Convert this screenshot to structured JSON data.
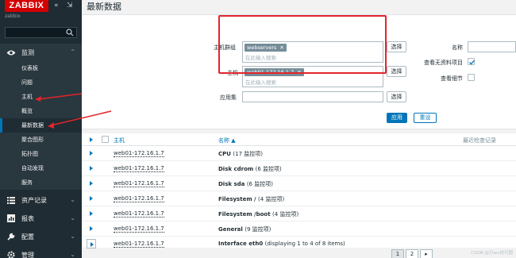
{
  "brand": {
    "logo": "ZABBIX",
    "collapse_icon": "«",
    "popout_icon": "⇲",
    "server_name": "zabbix"
  },
  "search": {
    "placeholder": "",
    "icon": "search-icon"
  },
  "sidebar": {
    "monitoring": {
      "label": "监测",
      "icon": "eye-icon"
    },
    "monitoring_items": [
      {
        "label": "仪表板"
      },
      {
        "label": "问题"
      },
      {
        "label": "主机"
      },
      {
        "label": "概览"
      },
      {
        "label": "最新数据",
        "active": true
      },
      {
        "label": "聚合图形"
      },
      {
        "label": "拓扑图"
      },
      {
        "label": "自动发现"
      },
      {
        "label": "服务"
      }
    ],
    "sections": [
      {
        "label": "资产记录",
        "icon": "list-icon"
      },
      {
        "label": "报表",
        "icon": "chart-icon"
      },
      {
        "label": "配置",
        "icon": "wrench-icon"
      },
      {
        "label": "管理",
        "icon": "gear-icon"
      }
    ]
  },
  "page": {
    "title": "最新数据"
  },
  "filter": {
    "host_groups": {
      "label": "主机群组",
      "tag": "webservers",
      "placeholder": "在此输入搜索",
      "select_label": "选择"
    },
    "hosts": {
      "label": "主机",
      "tag": "web01-172.16.1.7",
      "placeholder": "在此输入搜索",
      "select_label": "选择"
    },
    "application": {
      "label": "应用集",
      "value": "",
      "select_label": "选择"
    },
    "name": {
      "label": "名称",
      "value": ""
    },
    "show_items_without_data": {
      "label": "查看无资料项目",
      "checked": true
    },
    "show_details": {
      "label": "查看细节",
      "checked": false
    },
    "apply_label": "应用",
    "reset_label": "重设"
  },
  "table": {
    "columns": {
      "host": "主机",
      "name": "名称 ▲",
      "last_check": "最近检查记录"
    },
    "rows": [
      {
        "host": "web01-172.16.1.7",
        "app": "CPU",
        "count": "(17 监控项)"
      },
      {
        "host": "web01-172.16.1.7",
        "app": "Disk cdrom",
        "count": "(6 监控项)"
      },
      {
        "host": "web01-172.16.1.7",
        "app": "Disk sda",
        "count": "(6 监控项)"
      },
      {
        "host": "web01-172.16.1.7",
        "app": "Filesystem /",
        "count": "(4 监控项)"
      },
      {
        "host": "web01-172.16.1.7",
        "app": "Filesystem /boot",
        "count": "(4 监控项)"
      },
      {
        "host": "web01-172.16.1.7",
        "app": "General",
        "count": "(9 监控项)"
      },
      {
        "host": "web01-172.16.1.7",
        "app": "Interface eth0",
        "count": "(displaying 1 to 4 of 8 items)",
        "expanded": true
      }
    ]
  },
  "pager": {
    "pages": [
      "1",
      "2"
    ],
    "next": "▸",
    "current": "1"
  },
  "watermark": "CSDN @万wu技可圆",
  "colors": {
    "sidebar_bg": "#1f2c33",
    "brand_red": "#d40000",
    "accent_blue": "#0275b8",
    "highlight_red": "#e3242b"
  }
}
